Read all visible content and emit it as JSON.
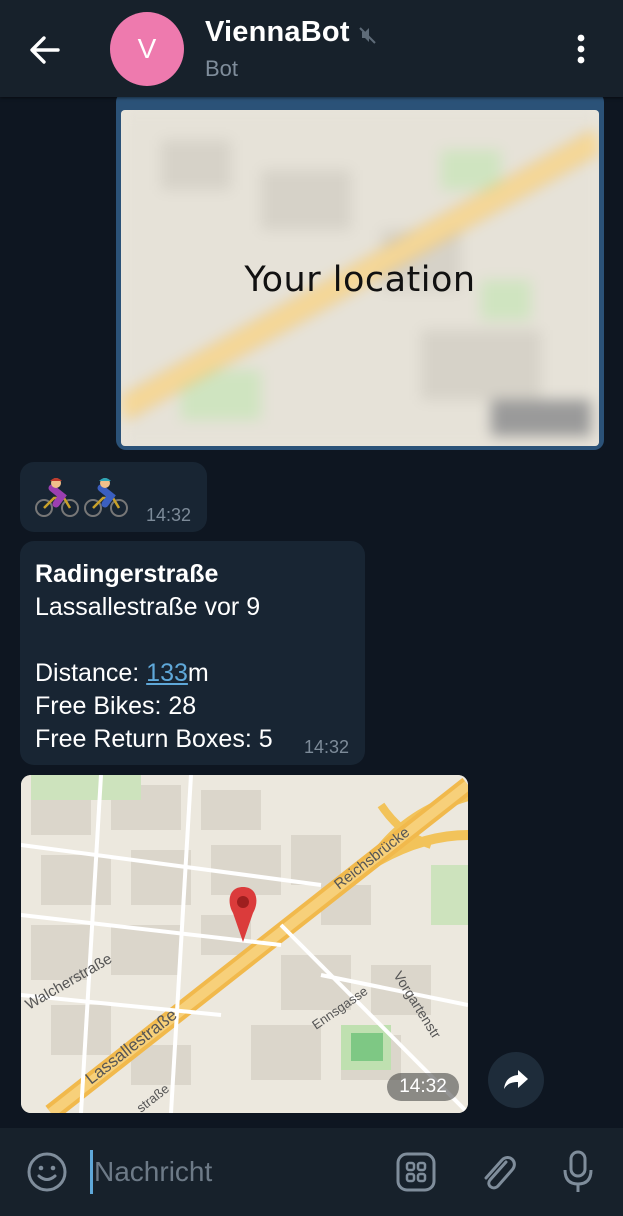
{
  "header": {
    "avatar_letter": "V",
    "title": "ViennaBot",
    "subtitle": "Bot",
    "avatar_color": "#ee7aae",
    "icons": [
      "back-arrow-icon",
      "muted-icon",
      "more-vertical-icon"
    ]
  },
  "messages": {
    "location": {
      "label": "Your location"
    },
    "emoji_msg": {
      "emojis": [
        "woman-biking",
        "person-biking"
      ],
      "time": "14:32"
    },
    "station": {
      "name": "Radingerstraße",
      "address": "Lassallestraße vor 9",
      "distance_label": "Distance: ",
      "distance_value": "133",
      "distance_unit": "m",
      "free_bikes": "Free Bikes: 28",
      "free_boxes": "Free Return Boxes: 5",
      "time": "14:32"
    },
    "map": {
      "streets": [
        "Reichsbrücke",
        "Walcherstraße",
        "Lassallestraße",
        "Ennsgasse",
        "Vorgartenstr",
        "straße"
      ],
      "time": "14:32"
    }
  },
  "input": {
    "placeholder": "Nachricht"
  },
  "colors": {
    "background": "#0e1621",
    "header": "#17212b",
    "incoming": "#182533",
    "outgoing": "#2b5278",
    "link": "#5fa8d9"
  }
}
